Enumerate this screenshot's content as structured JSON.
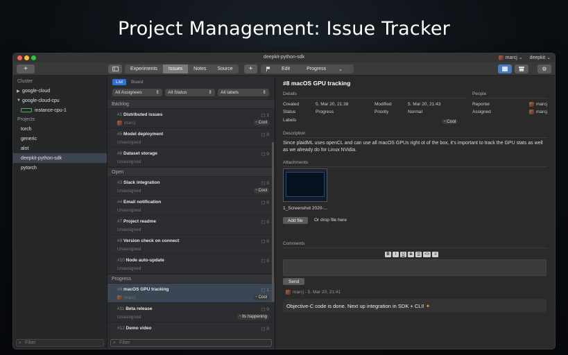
{
  "hero_title": "Project Management: Issue Tracker",
  "window": {
    "title": "deepkit-python-sdk",
    "user": "marcj",
    "org": "deepkit"
  },
  "toolbar": {
    "add_label": "+",
    "tabs": [
      "Experiments",
      "Issues",
      "Notes",
      "Source"
    ],
    "active_tab": "Issues",
    "new_label": "+",
    "edit_label": "Edit",
    "status_label": "Progress"
  },
  "sidebar": {
    "cluster_heading": "Cluster",
    "clusters": [
      {
        "label": "google-cloud",
        "expanded": false
      },
      {
        "label": "google-cloud-cpu",
        "expanded": true
      }
    ],
    "instance": "instance-cpu-1",
    "projects_heading": "Projects",
    "projects": [
      "torch",
      "generic",
      "alot",
      "deepkit-python-sdk",
      "pytorch"
    ],
    "selected_project": "deepkit-python-sdk",
    "filter_placeholder": "Filter"
  },
  "list": {
    "view_tabs": [
      "List",
      "Board"
    ],
    "filters": [
      "All Assignees",
      "All Status",
      "All labels"
    ],
    "groups": [
      {
        "name": "Backlog",
        "issues": [
          {
            "num": "#1",
            "title": "Distributed issues",
            "assignee": "marcj",
            "comments": "1",
            "tag": "Cool"
          },
          {
            "num": "#5",
            "title": "Model deployment",
            "assignee": "Unassigned",
            "comments": "0",
            "tag": ""
          },
          {
            "num": "#6",
            "title": "Dataset storage",
            "assignee": "Unassigned",
            "comments": "0",
            "tag": ""
          }
        ]
      },
      {
        "name": "Open",
        "issues": [
          {
            "num": "#3",
            "title": "Slack integration",
            "assignee": "Unassigned",
            "comments": "0",
            "tag": "Cool"
          },
          {
            "num": "#4",
            "title": "Email notification",
            "assignee": "Unassigned",
            "comments": "0",
            "tag": ""
          },
          {
            "num": "#7",
            "title": "Project readme",
            "assignee": "Unassigned",
            "comments": "0",
            "tag": ""
          },
          {
            "num": "#9",
            "title": "Version check on connect",
            "assignee": "Unassigned",
            "comments": "0",
            "tag": ""
          },
          {
            "num": "#10",
            "title": "Node auto-update",
            "assignee": "Unassigned",
            "comments": "0",
            "tag": ""
          }
        ]
      },
      {
        "name": "Progress",
        "issues": [
          {
            "num": "#8",
            "title": "macOS GPU tracking",
            "assignee": "marcj",
            "comments": "1",
            "tag": "Cool"
          },
          {
            "num": "#11",
            "title": "Beta release",
            "assignee": "Unassigned",
            "comments": "0",
            "tag": "Its happening"
          },
          {
            "num": "#12",
            "title": "Demo video",
            "assignee": "",
            "comments": "0",
            "tag": ""
          }
        ]
      }
    ],
    "filter_placeholder": "Filter"
  },
  "detail": {
    "title": "#8 macOS GPU tracking",
    "details_heading": "Details",
    "people_heading": "People",
    "created_label": "Created",
    "created": "5. Mar 20, 21:38",
    "modified_label": "Modified",
    "modified": "5. Mar 20, 21:43",
    "status_label": "Status",
    "status": "Progress",
    "priority_label": "Priority",
    "priority": "Normal",
    "labels_label": "Labels",
    "label_tag": "Cool",
    "reporter_label": "Reporter",
    "reporter": "marcj",
    "assigned_label": "Assigned",
    "assigned": "marcj",
    "description_heading": "Description",
    "description": "Since plaidML uses openCL and can use all macOS GPUs right ot of the box, it's important to track the GPU stats as well as we already do for Linux NVidia.",
    "attachments_heading": "Attachments",
    "attachment_name": "1_Screenshot 2020-...",
    "add_file_label": "Add file",
    "drop_text": "Or drop file here",
    "comments_heading": "Comments",
    "format_buttons": [
      "B",
      "I",
      "U",
      "S",
      "☰",
      "<>",
      "≡"
    ],
    "send_label": "Send",
    "comment_meta": "marcj - 5. Mar 20, 21:41",
    "comment_text": "Objective-C code is done. Next up integration in SDK + CLI!"
  }
}
